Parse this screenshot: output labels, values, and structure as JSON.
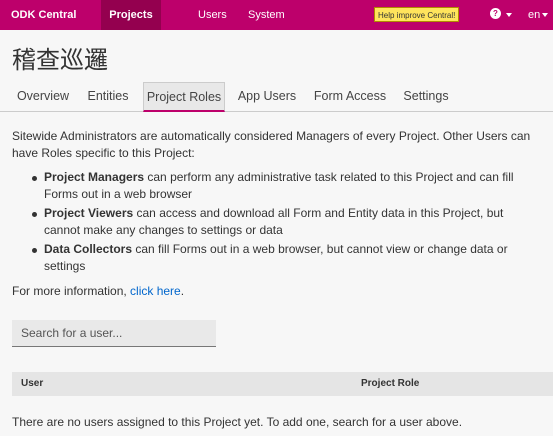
{
  "navbar": {
    "brand": "ODK Central",
    "items": [
      {
        "label": "Projects"
      },
      {
        "label": "Users"
      },
      {
        "label": "System"
      }
    ],
    "help_badge": "Help improve Central!",
    "help_glyph": "?",
    "language": "en"
  },
  "page": {
    "title": "稽查巡邏"
  },
  "tabs": [
    {
      "label": "Overview"
    },
    {
      "label": "Entities"
    },
    {
      "label": "Project Roles"
    },
    {
      "label": "App Users"
    },
    {
      "label": "Form Access"
    },
    {
      "label": "Settings"
    }
  ],
  "intro": "Sitewide Administrators are automatically considered Managers of every Project. Other Users can have Roles specific to this Project:",
  "roles": [
    {
      "name": "Project Managers",
      "desc": " can perform any administrative task related to this Project and can fill Forms out in a web browser"
    },
    {
      "name": "Project Viewers",
      "desc": " can access and download all Form and Entity data in this Project, but cannot make any changes to settings or data"
    },
    {
      "name": "Data Collectors",
      "desc": " can fill Forms out in a web browser, but cannot view or change data or settings"
    }
  ],
  "more_info": {
    "prefix": "For more information, ",
    "link": "click here",
    "suffix": "."
  },
  "search": {
    "placeholder": "Search for a user..."
  },
  "table": {
    "columns": [
      "User",
      "Project Role"
    ],
    "empty_message": "There are no users assigned to this Project yet. To add one, search for a user above."
  }
}
